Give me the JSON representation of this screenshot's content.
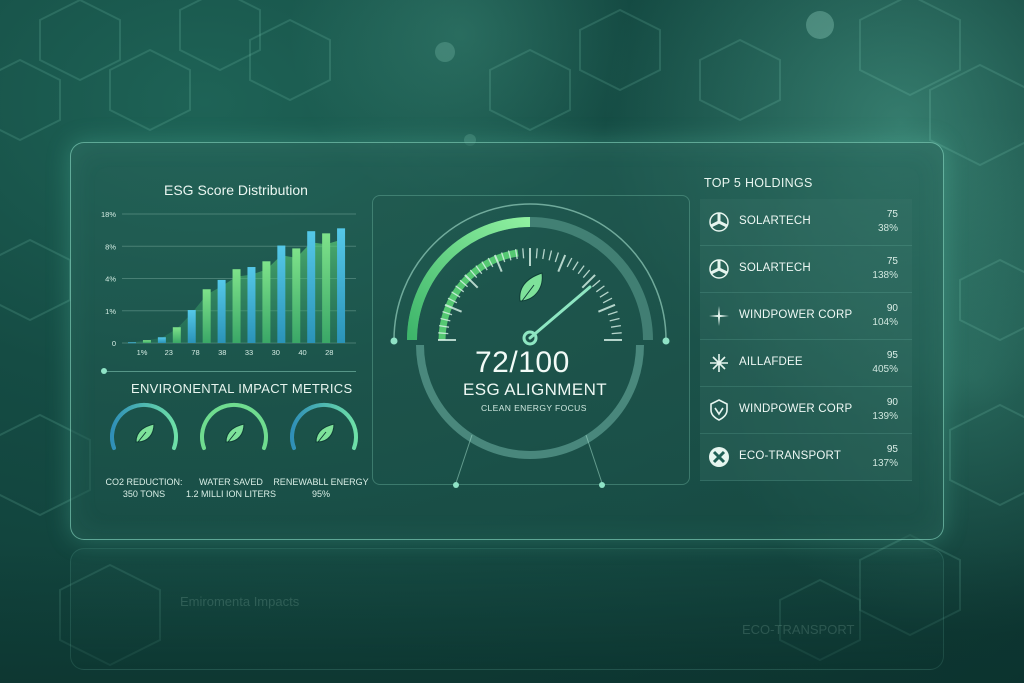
{
  "colors": {
    "accent_green": "#5fd37a",
    "accent_blue": "#3fb8d8",
    "text": "#eaf6f1"
  },
  "distribution": {
    "title": "ESG Score Distribution",
    "y_ticks": [
      "18%",
      "8%",
      "4%",
      "1%",
      "0"
    ],
    "x_ticks": [
      "1%",
      "23",
      "78",
      "38",
      "33",
      "30",
      "40",
      "28"
    ]
  },
  "chart_data": {
    "type": "bar",
    "title": "ESG Score Distribution",
    "categories": [
      "1%",
      "23",
      "78",
      "38",
      "33",
      "30",
      "40",
      "28"
    ],
    "series": [
      {
        "values": [
          0.1,
          0.4,
          0.8,
          2.2,
          4.6,
          7.5,
          8.8,
          10.3,
          10.6,
          11.4,
          13.6,
          13.2,
          15.6,
          15.3,
          16.0
        ]
      }
    ],
    "y_tick_labels": [
      "18%",
      "8%",
      "4%",
      "1%",
      "0"
    ],
    "ylim": [
      0,
      18
    ]
  },
  "impact": {
    "title": "ENVIRONENTAL IMPACT METRICS",
    "gauges": [
      {
        "line1": "CO2 REDUCTION:",
        "line2": "350 TONS",
        "icon": "leaf-icon"
      },
      {
        "line1": "WATER SAVED",
        "line2": "1.2 MILLI ION LITERS",
        "icon": "leaf-icon"
      },
      {
        "line1": "RENEWABLL ENERGY",
        "line2": "95%",
        "icon": "leaf-icon"
      }
    ]
  },
  "alignment": {
    "score": "72/100",
    "label": "ESG ALIGNMENT",
    "sublabel": "CLEAN ENERGY FOCUS",
    "value": 0.72
  },
  "holdings": {
    "title": "TOP 5 HOLDINGS",
    "items": [
      {
        "name": "SOLARTECH",
        "score": "75",
        "pct": "38%",
        "icon": "solar-icon"
      },
      {
        "name": "SOLARTECH",
        "score": "75",
        "pct": "138%",
        "icon": "solar-icon"
      },
      {
        "name": "WINDPOWER CORP",
        "score": "90",
        "pct": "104%",
        "icon": "wind-icon"
      },
      {
        "name": "AILLAFDEE",
        "score": "95",
        "pct": "405%",
        "icon": "star-icon"
      },
      {
        "name": "WINDPOWER CORP",
        "score": "90",
        "pct": "139%",
        "icon": "shield-icon"
      },
      {
        "name": "ECO-TRANSPORT",
        "score": "95",
        "pct": "137%",
        "icon": "cross-icon"
      }
    ]
  },
  "reflection": {
    "left_text": "Emiromenta Impacts",
    "right_text": "ECO-TRANSPORT"
  }
}
